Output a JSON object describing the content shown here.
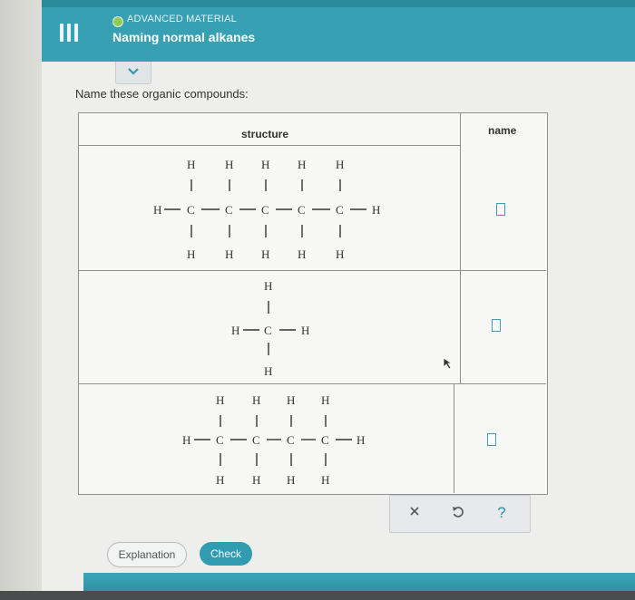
{
  "header": {
    "status_icon": "status-dot-icon",
    "subtitle": "ADVANCED MATERIAL",
    "title": "Naming normal alkanes",
    "menu_icon": "menu-icon"
  },
  "collapse_icon": "chevron-down-icon",
  "prompt": "Name these organic compounds:",
  "table": {
    "headers": {
      "structure": "structure",
      "name": "name"
    },
    "rows": [
      {
        "molecule": "pentane-structure",
        "carbons": 5,
        "name_value": ""
      },
      {
        "molecule": "methane-structure",
        "carbons": 1,
        "name_value": ""
      },
      {
        "molecule": "butane-structure",
        "carbons": 4,
        "name_value": ""
      }
    ]
  },
  "toolbar": {
    "clear_icon": "close-icon",
    "undo_icon": "undo-icon",
    "help_label": "?"
  },
  "buttons": {
    "explanation": "Explanation",
    "check": "Check"
  },
  "colors": {
    "header": "#37a0b3",
    "accent": "#2f9cb2",
    "status": "#8fce4f"
  }
}
